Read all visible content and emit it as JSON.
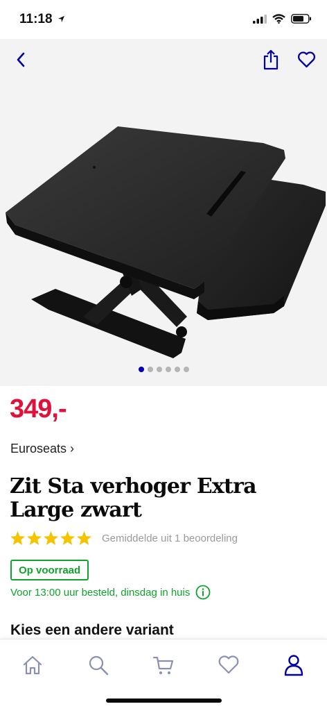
{
  "status_bar": {
    "time": "11:18"
  },
  "gallery": {
    "image_count": 6,
    "active_index": 0
  },
  "product": {
    "price": "349,-",
    "brand": "Euroseats ›",
    "title": "Zit Sta verhoger Extra Large zwart",
    "rating_stars": 5,
    "rating_text": "Gemiddelde uit 1 beoordeling",
    "stock": "Op voorraad",
    "delivery": "Voor 13:00 uur besteld, dinsdag in huis"
  },
  "variants": {
    "heading": "Kies een andere variant"
  },
  "tabbar": {
    "items": [
      "home-icon",
      "search-icon",
      "cart-icon",
      "heart-icon",
      "account-icon"
    ],
    "active": "account-icon"
  },
  "colors": {
    "brand_blue": "#0000a4",
    "price_red": "#e0113a",
    "stock_green": "#0ea32b",
    "star_yellow": "#f5c400",
    "tab_icon": "#8a8fb3"
  }
}
